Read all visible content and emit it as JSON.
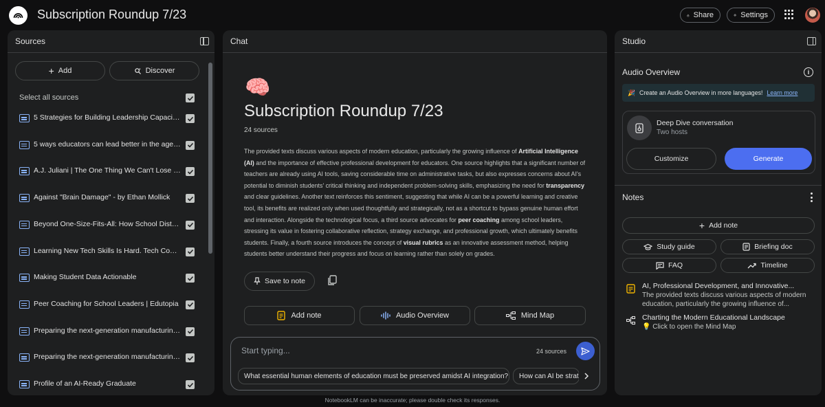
{
  "app": {
    "title": "Subscription Roundup 7/23"
  },
  "header": {
    "share_label": "Share",
    "settings_label": "Settings"
  },
  "sources": {
    "title": "Sources",
    "add_label": "Add",
    "discover_label": "Discover",
    "select_all_label": "Select all sources",
    "items": [
      {
        "label": "5 Strategies for Building Leadership Capacity i..."
      },
      {
        "label": "5 ways educators can lead better in the age of ..."
      },
      {
        "label": "A.J. Juliani | The One Thing We Can't Lose in th..."
      },
      {
        "label": "Against \"Brain Damage\" - by Ethan Mollick"
      },
      {
        "label": "Beyond One-Size-Fits-All: How School Districts..."
      },
      {
        "label": "Learning New Tech Skills Is Hard. Tech Coache..."
      },
      {
        "label": "Making Student Data Actionable"
      },
      {
        "label": "Peer Coaching for School Leaders | Edutopia"
      },
      {
        "label": "Preparing the next-generation manufacturing ..."
      },
      {
        "label": "Preparing the next-generation manufacturing ..."
      },
      {
        "label": "Profile of an AI-Ready Graduate"
      }
    ]
  },
  "chat": {
    "title": "Chat",
    "notebook_emoji": "🧠",
    "notebook_title": "Subscription Roundup 7/23",
    "source_count": "24 sources",
    "summary": [
      {
        "text": "The provided texts discuss various aspects of modern education, particularly the growing influence of ",
        "bold": false
      },
      {
        "text": "Artificial Intelligence (AI)",
        "bold": true
      },
      {
        "text": " and the importance of effective professional development for educators. One source highlights that a significant number of teachers are already using AI tools, saving considerable time on administrative tasks, but also expresses concerns about AI's potential to diminish students' critical thinking and independent problem-solving skills, emphasizing the need for ",
        "bold": false
      },
      {
        "text": "transparency",
        "bold": true
      },
      {
        "text": " and clear guidelines. Another text reinforces this sentiment, suggesting that while AI can be a powerful learning and creative tool, its benefits are realized only when used thoughtfully and strategically, not as a shortcut to bypass genuine human effort and interaction. Alongside the technological focus, a third source advocates for ",
        "bold": false
      },
      {
        "text": "peer coaching",
        "bold": true
      },
      {
        "text": " among school leaders, stressing its value in fostering collaborative reflection, strategy exchange, and professional growth, which ultimately benefits students. Finally, a fourth source introduces the concept of ",
        "bold": false
      },
      {
        "text": "visual rubrics",
        "bold": true
      },
      {
        "text": " as an innovative assessment method, helping students better understand their progress and focus on learning rather than solely on grades.",
        "bold": false
      }
    ],
    "save_note_label": "Save to note",
    "actions": {
      "add_note": "Add note",
      "audio_overview": "Audio Overview",
      "mind_map": "Mind Map"
    },
    "input": {
      "placeholder": "Start typing...",
      "source_count": "24 sources"
    },
    "suggestions": [
      "What essential human elements of education must be preserved amidst AI integration?",
      "How can AI be strat"
    ]
  },
  "studio": {
    "title": "Studio",
    "audio_overview_label": "Audio Overview",
    "banner_text": "Create an Audio Overview in more languages!",
    "banner_link": "Learn more",
    "deep_dive_title": "Deep Dive conversation",
    "deep_dive_sub": "Two hosts",
    "customize_label": "Customize",
    "generate_label": "Generate",
    "notes_label": "Notes",
    "add_note_label": "Add note",
    "chips": {
      "study_guide": "Study guide",
      "briefing_doc": "Briefing doc",
      "faq": "FAQ",
      "timeline": "Timeline"
    },
    "notes": [
      {
        "title": "AI, Professional Development, and Innovative...",
        "text": "The provided texts discuss various aspects of modern education, particularly the growing influence of...",
        "icon": "note-icon"
      },
      {
        "title": "Charting the Modern Educational Landscape",
        "text": "💡 Click to open the Mind Map",
        "icon": "mind-map-icon"
      }
    ]
  },
  "footer": {
    "disclaimer": "NotebookLM can be inaccurate; please double check its responses."
  },
  "colors": {
    "accent": "#4c6ef0",
    "link": "#8ab4f8",
    "panel_bg": "#1e1f20",
    "page_bg": "#0f0f10"
  }
}
